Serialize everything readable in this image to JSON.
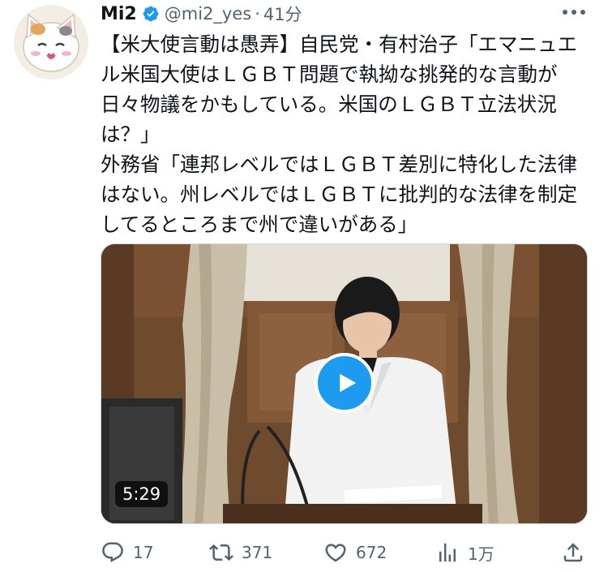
{
  "tweet": {
    "author_name": "Mi2",
    "handle": "@mi2_yes",
    "separator": "·",
    "time": "41分",
    "paragraphs": [
      "【米大使言動は愚弄】自民党・有村治子「エマニュエル米国大使はＬＧＢＴ問題で執拗な挑発的な言動が日々物議をかもしている。米国のＬＧＢＴ立法状況は？」",
      "外務省「連邦レベルではＬＧＢＴ差別に特化した法律はない。州レベルではＬＧＢＴに批判的な法律を制定してるところまで州で違いがある」"
    ],
    "video_duration": "5:29"
  },
  "actions": {
    "reply_count": "17",
    "retweet_count": "371",
    "like_count": "672",
    "view_count": "1万"
  },
  "icons": {
    "verified": "verified-badge-icon",
    "more": "more-icon",
    "play": "play-icon",
    "reply": "reply-icon",
    "retweet": "retweet-icon",
    "like": "heart-icon",
    "views": "views-icon",
    "share": "share-icon"
  },
  "colors": {
    "accent": "#1d9bf0",
    "text": "#0f1419",
    "secondary": "#536471"
  }
}
